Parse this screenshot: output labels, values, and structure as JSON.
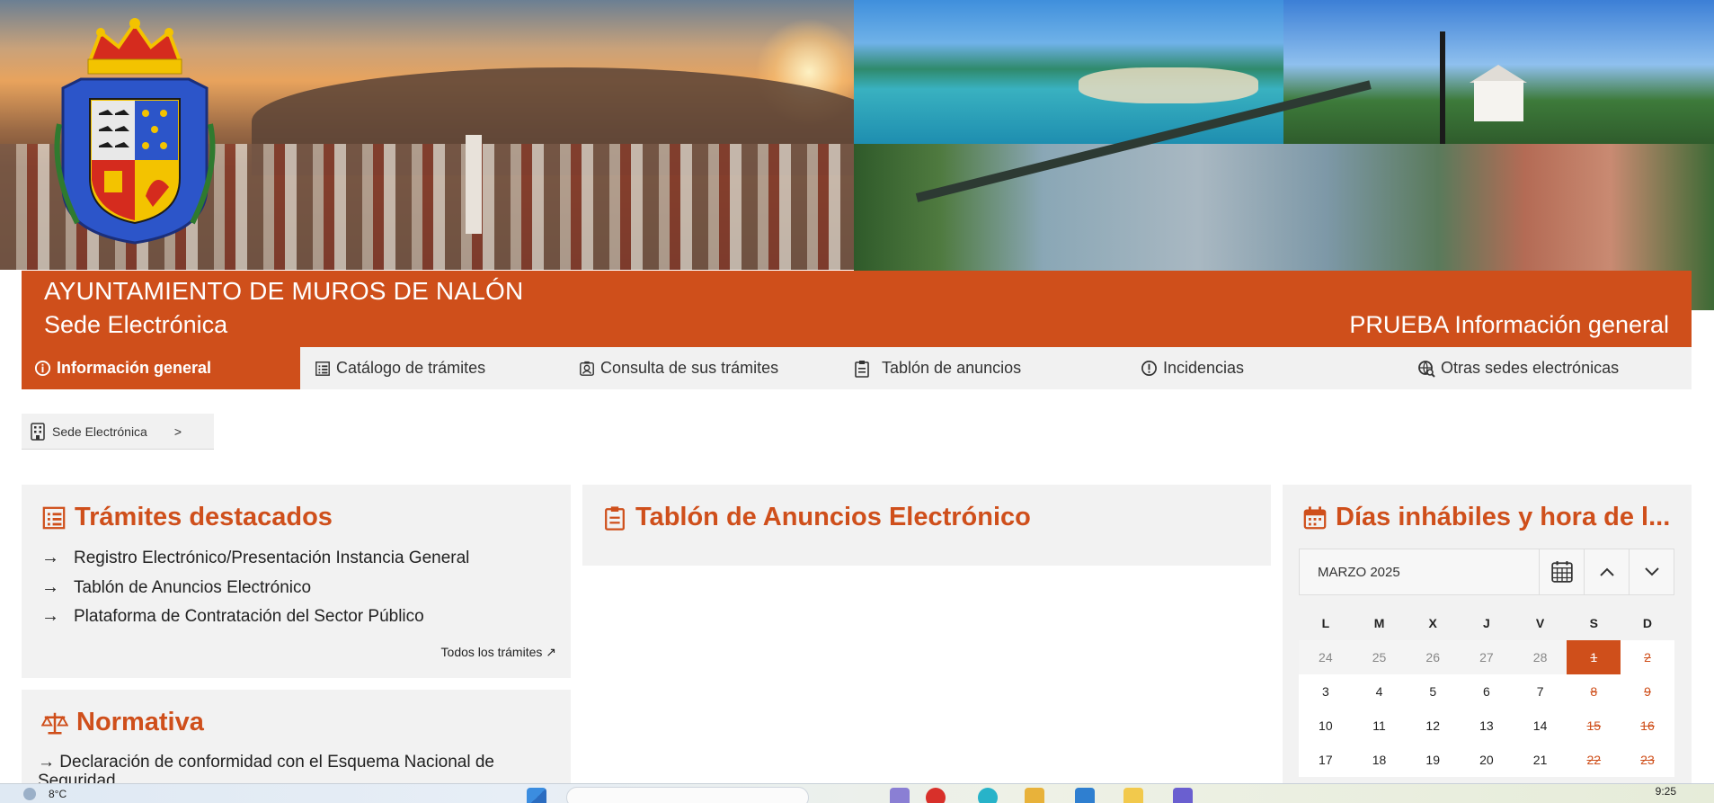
{
  "header": {
    "title_line1": "AYUNTAMIENTO DE MUROS DE NALÓN",
    "title_line2": "Sede Electrónica",
    "section_title": "PRUEBA Información general"
  },
  "nav": {
    "items": [
      {
        "label": "Información general",
        "icon": "info-icon",
        "active": true
      },
      {
        "label": "Catálogo de trámites",
        "icon": "list-icon"
      },
      {
        "label": "Consulta de sus trámites",
        "icon": "user-badge-icon"
      },
      {
        "label": "Tablón de anuncios",
        "icon": "clipboard-icon"
      },
      {
        "label": "Incidencias",
        "icon": "alert-icon"
      },
      {
        "label": "Otras sedes electrónicas",
        "icon": "globe-search-icon"
      }
    ]
  },
  "breadcrumb": {
    "label": "Sede Electrónica",
    "separator": ">"
  },
  "tramites": {
    "title": "Trámites destacados",
    "links": [
      "Registro Electrónico/Presentación Instancia General",
      "Tablón de Anuncios Electrónico",
      "Plataforma de Contratación del Sector Público"
    ],
    "all_link": "Todos los trámites ↗"
  },
  "normativa": {
    "title": "Normativa",
    "link": "Declaración de conformidad con el Esquema Nacional de Seguridad"
  },
  "tablon": {
    "title": "Tablón de Anuncios Electrónico"
  },
  "calendar": {
    "title": "Días inhábiles y hora de l...",
    "month": "MARZO 2025",
    "weekdays": [
      "L",
      "M",
      "X",
      "J",
      "V",
      "S",
      "D"
    ],
    "weeks": [
      [
        "24",
        "25",
        "26",
        "27",
        "28",
        "1",
        "2"
      ],
      [
        "3",
        "4",
        "5",
        "6",
        "7",
        "8",
        "9"
      ],
      [
        "10",
        "11",
        "12",
        "13",
        "14",
        "15",
        "16"
      ],
      [
        "17",
        "18",
        "19",
        "20",
        "21",
        "22",
        "23"
      ]
    ]
  },
  "taskbar": {
    "temperature": "8°C",
    "time": "9:25"
  },
  "colors": {
    "accent": "#cf4f1b",
    "panel": "#f2f2f2",
    "nav": "#f1f1f1"
  }
}
